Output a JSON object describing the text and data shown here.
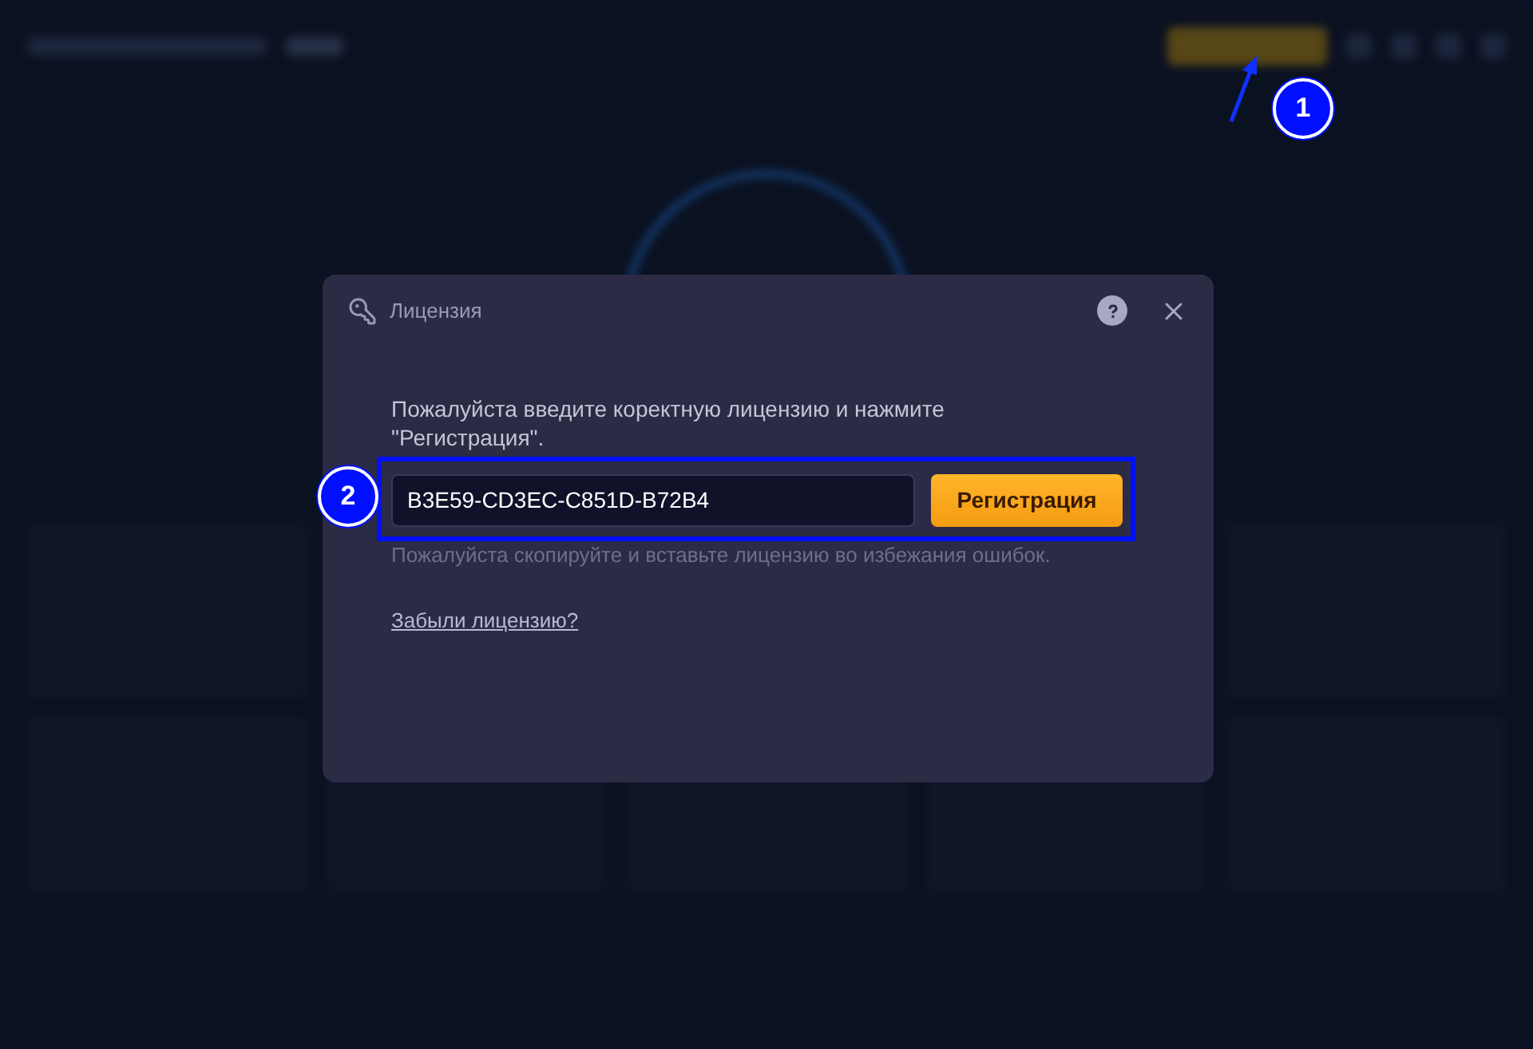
{
  "dialog": {
    "title": "Лицензия",
    "instruction": "Пожалуйста введите коректную лицензию и нажмите \"Регистрация\".",
    "license_field": {
      "value": "B3E59-CD3EC-C851D-B72B4"
    },
    "register_button": "Регистрация",
    "hint": "Пожалуйста скопируйте и вставьте лицензию во избежания ошибок.",
    "forgot_link": "Забыли лицензию?"
  },
  "callouts": [
    "1",
    "2"
  ]
}
